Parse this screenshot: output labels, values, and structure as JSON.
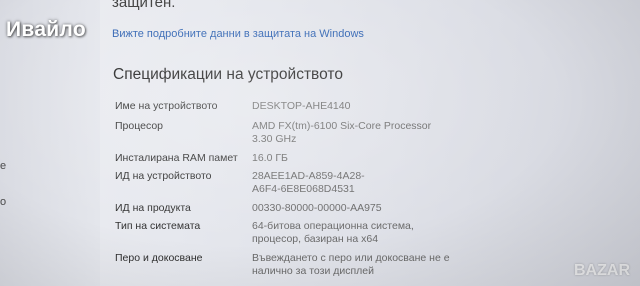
{
  "overlay": {
    "username": "Ивайло",
    "badge_text": "BAZAR"
  },
  "header": {
    "cut_text": "защитен.",
    "privacy_link": "Вижте подробните данни в защитата на Windows"
  },
  "left_strip": {
    "frag1": "е",
    "frag2": "о"
  },
  "specs": {
    "title": "Спецификации на устройството",
    "rows": [
      {
        "label": "Име на устройството",
        "value": [
          "DESKTOP-AHE4140"
        ]
      },
      {
        "label": "Процесор",
        "value": [
          "AMD FX(tm)-6100 Six-Core Processor",
          "3.30 GHz"
        ]
      },
      {
        "label": "Инсталирана RAM памет",
        "value": [
          "16.0 ГБ"
        ]
      },
      {
        "label": "ИД на устройството",
        "value": [
          "28AEE1AD-A859-4A28-",
          "A6F4-6E8E068D4531"
        ]
      },
      {
        "label": "ИД на продукта",
        "value": [
          "00330-80000-00000-AA975"
        ]
      },
      {
        "label": "Тип на системата",
        "value": [
          "64-битова операционна система,",
          "процесор, базиран на x64"
        ]
      },
      {
        "label": "Перо и докосване",
        "value": [
          "Въвеждането с перо или докосване не е",
          "налично за този дисплей"
        ]
      }
    ]
  }
}
